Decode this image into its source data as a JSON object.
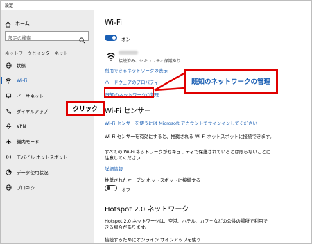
{
  "window": {
    "title": "設定"
  },
  "sidebar": {
    "home_label": "ホーム",
    "search_placeholder": "設定の検索",
    "section_header": "ネットワークとインターネット",
    "items": [
      {
        "label": "状態",
        "icon": "globe-icon",
        "active": false
      },
      {
        "label": "Wi-Fi",
        "icon": "wifi-icon",
        "active": true
      },
      {
        "label": "イーサネット",
        "icon": "ethernet-icon",
        "active": false
      },
      {
        "label": "ダイヤルアップ",
        "icon": "phone-icon",
        "active": false
      },
      {
        "label": "VPN",
        "icon": "vpn-icon",
        "active": false
      },
      {
        "label": "機内モード",
        "icon": "airplane-icon",
        "active": false
      },
      {
        "label": "モバイル ホットスポット",
        "icon": "hotspot-icon",
        "active": false
      },
      {
        "label": "データ使用状況",
        "icon": "data-usage-icon",
        "active": false
      },
      {
        "label": "プロキシ",
        "icon": "globe-icon",
        "active": false
      }
    ]
  },
  "main": {
    "title": "Wi-Fi",
    "wifi_toggle_label": "オン",
    "network_status": "接続済み、セキュリティ保護あり",
    "show_networks_link": "利用できるネットワークの表示",
    "hardware_props_link": "ハードウェアのプロパティ",
    "manage_known_link": "既知のネットワークの管理",
    "sense_heading": "Wi-Fi センサー",
    "sense_signin_link": "Wi-Fi センサーを使うには Microsoft アカウントでサインインしてください",
    "sense_desc": "Wi-Fi センサーを有効にすると、推奨される Wi-Fi ホットスポットに接続できます。",
    "sense_note_line1": "すべての Wi-Fi ネットワークがセキュリティで保護されているとは限らないことに",
    "sense_note_line2": "注意してください",
    "details_link": "詳細情報",
    "open_hotspot_label": "推奨されたオープン ホットスポットに接続する",
    "open_hotspot_toggle_label": "オフ",
    "hotspot20_heading": "Hotspot 2.0 ネットワーク",
    "hotspot20_desc_line1": "Hotspot 2.0 ネットワークは、空港、ホテル、カフェなどの公共の場所で利用で",
    "hotspot20_desc_line2": "きる場合があります。",
    "hotspot20_more": "接続するためにオンライン サインアップを使う"
  },
  "callouts": {
    "main_label": "既知のネットワークの管理",
    "click_label": "クリック"
  },
  "colors": {
    "accent": "#1a5fb4",
    "callout_border": "#e00000",
    "sidebar_bg": "#ececec"
  }
}
